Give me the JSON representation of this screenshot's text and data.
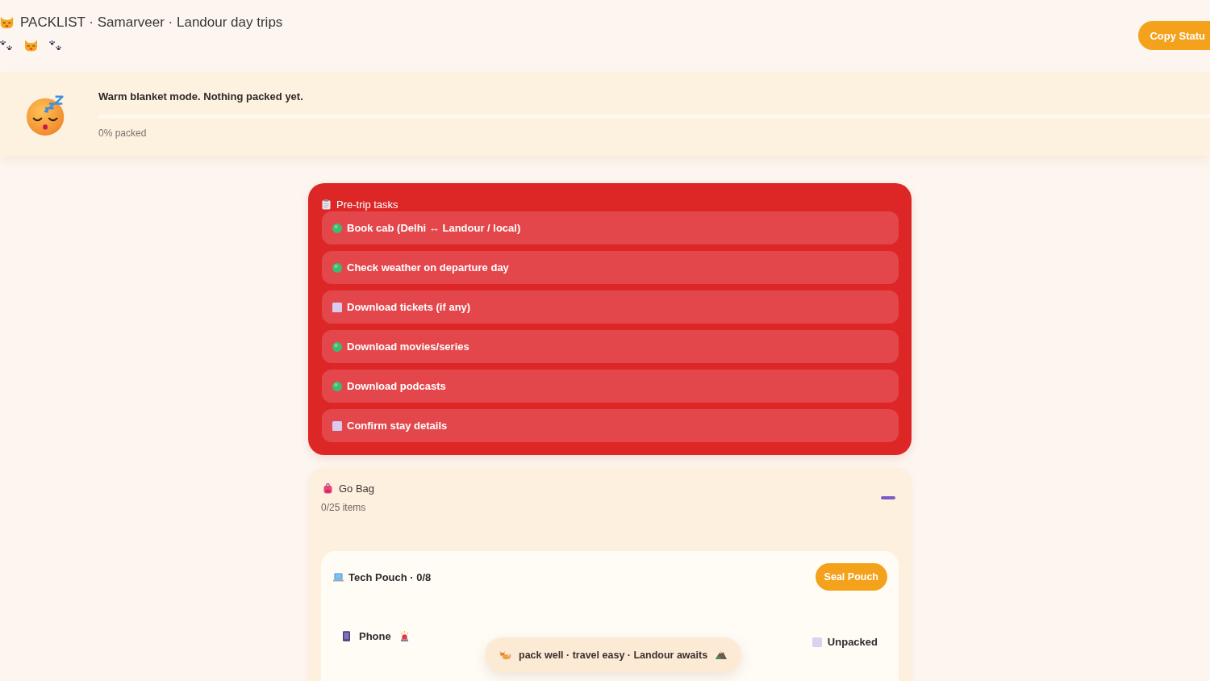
{
  "header": {
    "title": "PACKLIST · Samarveer · Landour day trips",
    "copy_button": "Copy Statu"
  },
  "banner": {
    "message": "Warm blanket mode. Nothing packed yet.",
    "level": 0,
    "progress_label": "0% packed"
  },
  "pretrip": {
    "title": "Pre-trip tasks",
    "tasks": [
      {
        "label": "Book cab (Delhi ↔ Landour / local)",
        "done": true
      },
      {
        "label": "Check weather on departure day",
        "done": true
      },
      {
        "label": "Download tickets (if any)",
        "done": false
      },
      {
        "label": "Download movies/series",
        "done": true
      },
      {
        "label": "Download podcasts",
        "done": true
      },
      {
        "label": "Confirm stay details",
        "done": false
      }
    ]
  },
  "go_bag": {
    "title": "Go Bag",
    "count": "0/25 items",
    "expanded": true,
    "pouches": [
      {
        "title": "Tech Pouch · 0/8",
        "button": "Seal Pouch",
        "items": [
          {
            "name": "Phone",
            "essential": true,
            "packed": false,
            "status": "Unpacked"
          }
        ]
      }
    ]
  },
  "footer": {
    "text": "pack well · travel easy · Landour awaits"
  }
}
